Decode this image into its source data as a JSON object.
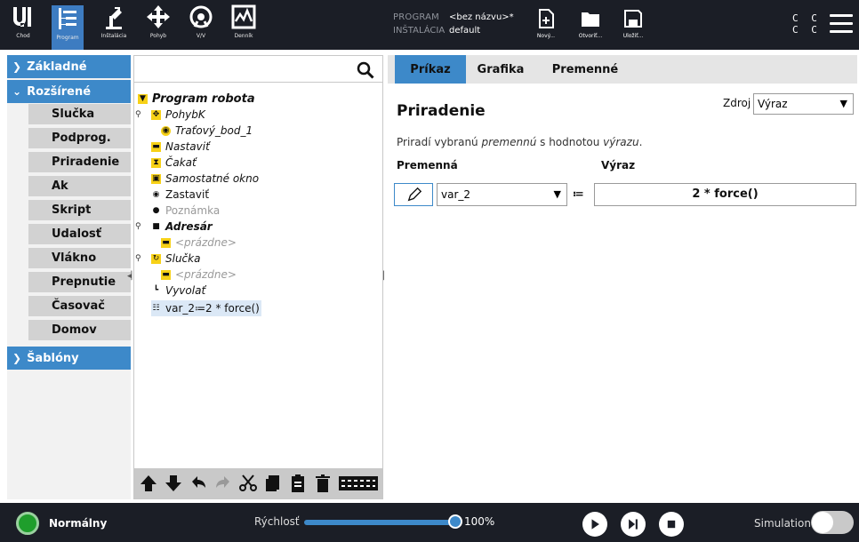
{
  "header": {
    "nav": [
      {
        "label": "Chod",
        "icon": "ur-logo-icon"
      },
      {
        "label": "Program",
        "icon": "program-icon"
      },
      {
        "label": "Inštalácia",
        "icon": "installation-icon"
      },
      {
        "label": "Pohyb",
        "icon": "move-icon"
      },
      {
        "label": "V/V",
        "icon": "io-icon"
      },
      {
        "label": "Denník",
        "icon": "log-icon"
      }
    ],
    "program_label": "PROGRAM",
    "program_value": "<bez názvu>*",
    "installation_label": "INŠTALÁCIA",
    "installation_value": "default",
    "file_buttons": [
      {
        "label": "Nový...",
        "icon": "new-file-icon"
      },
      {
        "label": "Otvoriť...",
        "icon": "open-folder-icon"
      },
      {
        "label": "Uložiť...",
        "icon": "save-icon"
      }
    ],
    "cc_line1": "C C",
    "cc_line2": "C C"
  },
  "sidebar": {
    "basic": "Základné",
    "advanced": "Rozšírené",
    "advanced_items": [
      "Slučka",
      "Podprog.",
      "Priradenie",
      "Ak",
      "Skript",
      "Udalosť",
      "Vlákno",
      "Prepnutie",
      "Časovač",
      "Domov"
    ],
    "templates": "Šablóny"
  },
  "tree": {
    "search_placeholder": "",
    "nodes": [
      {
        "text": "Program robota",
        "icon": "yellow-triangle-icon"
      },
      {
        "text": "PohybK",
        "icon": "move-cross-icon"
      },
      {
        "text": "Traťový_bod_1",
        "icon": "waypoint-icon"
      },
      {
        "text": "Nastaviť",
        "icon": "set-icon"
      },
      {
        "text": "Čakať",
        "icon": "hourglass-icon"
      },
      {
        "text": "Samostatné okno",
        "icon": "popup-icon"
      },
      {
        "text": "Zastaviť",
        "icon": "stop-icon"
      },
      {
        "text": "Poznámka",
        "icon": "comment-icon"
      },
      {
        "text": "Adresár",
        "icon": "folder-icon"
      },
      {
        "text": "<prázdne>",
        "icon": "empty-icon"
      },
      {
        "text": "Slučka",
        "icon": "loop-icon"
      },
      {
        "text": "<prázdne>",
        "icon": "empty-icon"
      },
      {
        "text": "Vyvolať",
        "icon": "call-icon"
      },
      {
        "text": "var_2≔2 * force()",
        "icon": "assignment-icon"
      }
    ],
    "toolbar": [
      "move-up-icon",
      "move-down-icon",
      "undo-icon",
      "redo-icon",
      "cut-icon",
      "copy-icon",
      "paste-icon",
      "delete-icon",
      "suppress-icon"
    ]
  },
  "tabs": [
    "Príkaz",
    "Grafika",
    "Premenné"
  ],
  "command": {
    "title": "Priradenie",
    "source_label": "Zdroj",
    "source_value": "Výraz",
    "desc_prefix": "Priradí vybranú ",
    "desc_var": "premennú",
    "desc_mid": " s hodnotou ",
    "desc_expr": "výrazu",
    "desc_end": ".",
    "col_variable": "Premenná",
    "col_expression": "Výraz",
    "variable_value": "var_2",
    "assign_operator": "≔",
    "expression_value": "2 * force()"
  },
  "footer": {
    "status": "Normálny",
    "speed_label": "Rýchlosť",
    "speed_value": "100%",
    "speed_fraction": 1.0,
    "simulation_label": "Simulation"
  },
  "colors": {
    "accent": "#3d89c9",
    "header_bg": "#1b1e26",
    "status_green": "#1f9e2c"
  }
}
